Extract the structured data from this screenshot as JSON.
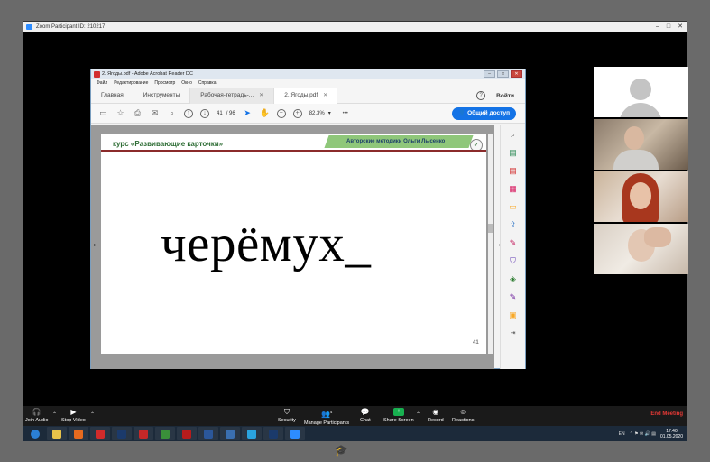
{
  "zoom": {
    "title": "Zoom Participant ID: 210217",
    "window_controls": [
      "–",
      "□",
      "✕"
    ],
    "controls": {
      "join_audio": "Join Audio",
      "stop_video": "Stop Video",
      "security": "Security",
      "manage_participants": "Manage Participants",
      "chat": "Chat",
      "share_screen": "Share Screen",
      "record": "Record",
      "reactions": "Reactions",
      "end_meeting": "End Meeting",
      "participant_count": "4"
    }
  },
  "acrobat": {
    "title": "2. Ягоды.pdf - Adobe Acrobat Reader DC",
    "menu": [
      "Файл",
      "Редактирование",
      "Просмотр",
      "Окно",
      "Справка"
    ],
    "tabs": {
      "home": "Главная",
      "tools": "Инструменты",
      "doc1": "Рабочая-тетрадь-...",
      "doc2": "2. Ягоды.pdf",
      "close": "✕"
    },
    "help": "?",
    "login": "Войти",
    "page_current": "41",
    "page_total": "/ 96",
    "zoom_level": "82,3%",
    "more": "•••",
    "share_label": "Общий доступ"
  },
  "page_content": {
    "course": "курс «Развивающие карточки»",
    "author": "Авторские методики Ольги Лысенко",
    "word": "черёмух_",
    "page_number": "41"
  },
  "taskbar": {
    "lang": "EN",
    "time": "17:40",
    "date": "01.05.2020",
    "apps": [
      {
        "name": "start",
        "color": "#2b7fd4"
      },
      {
        "name": "explorer",
        "color": "#e8c24a"
      },
      {
        "name": "firefox",
        "color": "#e66a1f"
      },
      {
        "name": "opera",
        "color": "#d12b2b"
      },
      {
        "name": "photoshop",
        "color": "#1b3a6b"
      },
      {
        "name": "acrobat",
        "color": "#c62828"
      },
      {
        "name": "chrome",
        "color": "#3a8f3a"
      },
      {
        "name": "acrobat-2",
        "color": "#b71c1c"
      },
      {
        "name": "word",
        "color": "#2b579a"
      },
      {
        "name": "mail",
        "color": "#3a6fb0"
      },
      {
        "name": "telegram",
        "color": "#2aa3df"
      },
      {
        "name": "photoshop-2",
        "color": "#1b3a6b"
      },
      {
        "name": "zoom",
        "color": "#2d8cff"
      }
    ]
  }
}
